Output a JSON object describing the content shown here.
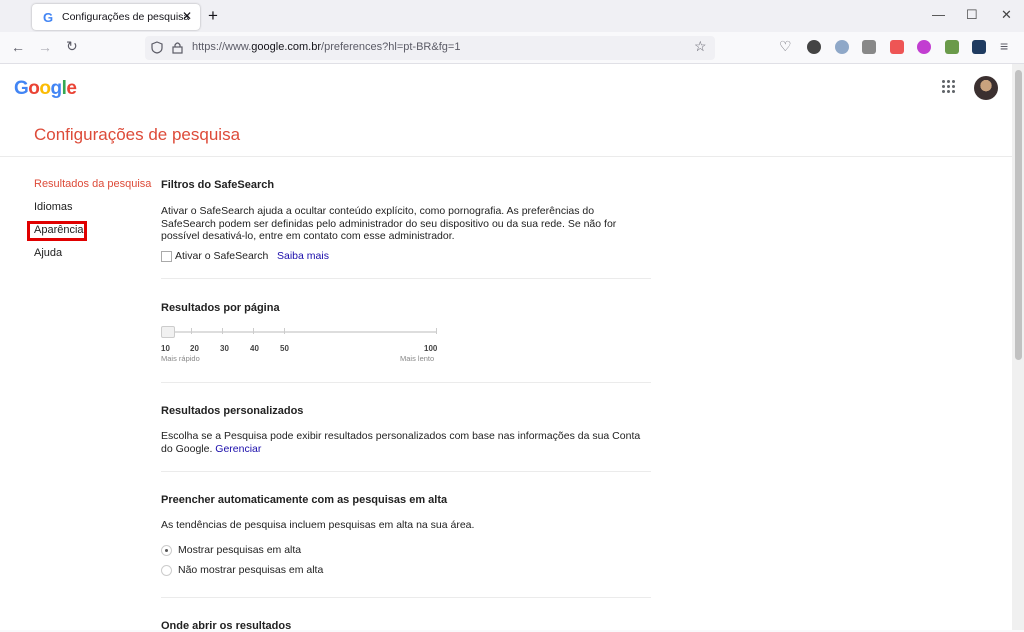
{
  "browser": {
    "tab_title": "Configurações de pesquisa",
    "tab_favicon": "G",
    "url_prefix": "https://www.",
    "url_host": "google.com.br",
    "url_rest": "/preferences?hl=pt-BR&fg=1"
  },
  "header": {
    "logo_letters": [
      "G",
      "o",
      "o",
      "g",
      "l",
      "e"
    ],
    "page_title": "Configurações de pesquisa"
  },
  "sidebar": {
    "items": [
      {
        "label": "Resultados da pesquisa"
      },
      {
        "label": "Idiomas"
      },
      {
        "label": "Aparência"
      },
      {
        "label": "Ajuda"
      }
    ]
  },
  "safesearch": {
    "title": "Filtros do SafeSearch",
    "description": "Ativar o SafeSearch ajuda a ocultar conteúdo explícito, como pornografia. As preferências do SafeSearch podem ser definidas pelo administrador do seu dispositivo ou da sua rede. Se não for possível desativá-lo, entre em contato com esse administrador.",
    "checkbox_label": "Ativar o SafeSearch",
    "learn_more": "Saiba mais"
  },
  "results_per_page": {
    "title": "Resultados por página",
    "ticks": [
      "10",
      "20",
      "30",
      "40",
      "50",
      "100"
    ],
    "min_label": "Mais rápido",
    "max_label": "Mais lento",
    "selected": "10"
  },
  "personalized": {
    "title": "Resultados personalizados",
    "description": "Escolha se a Pesquisa pode exibir resultados personalizados com base nas informações da sua Conta do Google.",
    "manage_link": "Gerenciar"
  },
  "trending": {
    "title": "Preencher automaticamente com as pesquisas em alta",
    "description": "As tendências de pesquisa incluem pesquisas em alta na sua área.",
    "options": [
      {
        "label": "Mostrar pesquisas em alta",
        "selected": true
      },
      {
        "label": "Não mostrar pesquisas em alta",
        "selected": false
      }
    ]
  },
  "open_results": {
    "title": "Onde abrir os resultados"
  }
}
